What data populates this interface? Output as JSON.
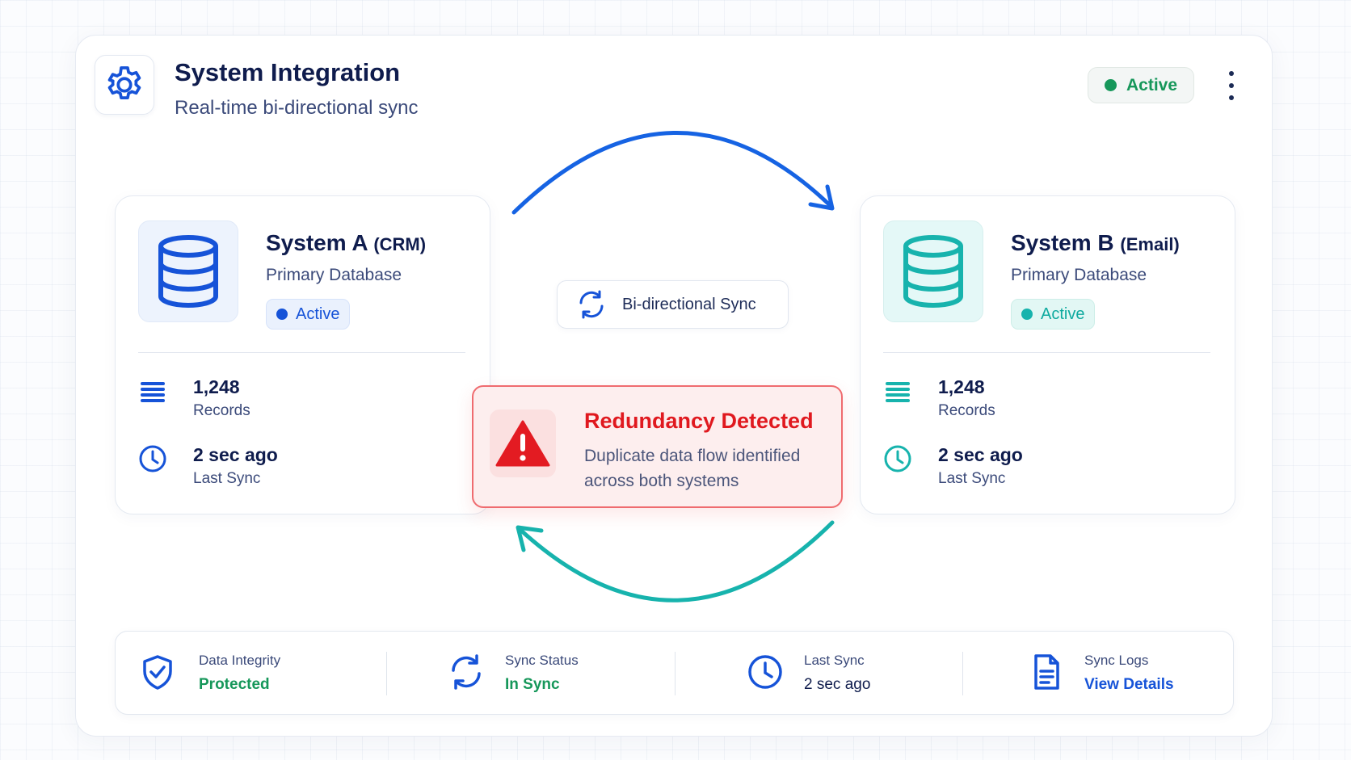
{
  "header": {
    "title": "System Integration",
    "subtitle": "Real-time bi-directional sync",
    "status": "Active",
    "icon": "gear-icon"
  },
  "systems": [
    {
      "name": "System A",
      "tag": "(CRM)",
      "subtitle": "Primary Database",
      "status": "Active",
      "records_value": "1,248",
      "records_label": "Records",
      "sync_value": "2 sec ago",
      "sync_label": "Last Sync",
      "color": "#1653d8"
    },
    {
      "name": "System B",
      "tag": "(Email)",
      "subtitle": "Primary Database",
      "status": "Active",
      "records_value": "1,248",
      "records_label": "Records",
      "sync_value": "2 sec ago",
      "sync_label": "Last Sync",
      "color": "#17b3ad"
    }
  ],
  "sync": {
    "label": "Bi-directional Sync"
  },
  "alert": {
    "title": "Redundancy Detected",
    "message": "Duplicate data flow identified across both systems",
    "color": "#e0191f"
  },
  "footer": [
    {
      "label": "Data Integrity",
      "value": "Protected",
      "icon": "shield-check-icon",
      "value_color": "#16975a"
    },
    {
      "label": "Sync Status",
      "value": "In Sync",
      "icon": "sync-icon",
      "value_color": "#16975a"
    },
    {
      "label": "Last Sync",
      "value": "2 sec ago",
      "icon": "clock-icon",
      "value_color": "#0f1c4d"
    },
    {
      "label": "Sync Logs",
      "value": "View Details",
      "icon": "document-icon",
      "value_color": "#1653d8"
    }
  ],
  "colors": {
    "primary_blue": "#1653d8",
    "teal": "#17b3ad",
    "green": "#16975a",
    "red": "#e0191f",
    "navy": "#0f1c4d"
  }
}
